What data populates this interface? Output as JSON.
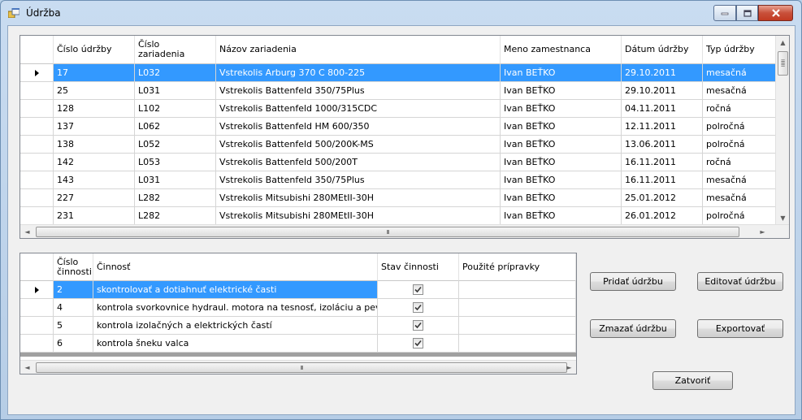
{
  "window": {
    "title": "Údržba",
    "icon": "app-form-icon",
    "buttons": {
      "minimize": "minimize-icon",
      "maximize": "maximize-icon",
      "close": "close-icon"
    }
  },
  "maintenance_grid": {
    "columns": [
      "Číslo údržby",
      "Číslo\nzariadenia",
      "Názov zariadenia",
      "Meno zamestnanca",
      "Dátum údržby",
      "Typ údržby"
    ],
    "rows": [
      [
        "17",
        "L032",
        "Vstrekolis Arburg 370 C 800-225",
        "Ivan BEŤKO",
        "29.10.2011",
        "mesačná"
      ],
      [
        "25",
        "L031",
        "Vstrekolis Battenfeld 350/75Plus",
        "Ivan BEŤKO",
        "29.10.2011",
        "mesačná"
      ],
      [
        "128",
        "L102",
        "Vstrekolis Battenfeld 1000/315CDC",
        "Ivan BEŤKO",
        "04.11.2011",
        "ročná"
      ],
      [
        "137",
        "L062",
        "Vstrekolis Battenfeld HM 600/350",
        "Ivan BEŤKO",
        "12.11.2011",
        "polročná"
      ],
      [
        "138",
        "L052",
        "Vstrekolis Battenfeld 500/200K-MS",
        "Ivan BEŤKO",
        "13.06.2011",
        "polročná"
      ],
      [
        "142",
        "L053",
        "Vstrekolis Battenfeld 500/200T",
        "Ivan BEŤKO",
        "16.11.2011",
        "ročná"
      ],
      [
        "143",
        "L031",
        "Vstrekolis Battenfeld 350/75Plus",
        "Ivan BEŤKO",
        "16.11.2011",
        "mesačná"
      ],
      [
        "227",
        "L282",
        "Vstrekolis Mitsubishi 280MEtII-30H",
        "Ivan BEŤKO",
        "25.01.2012",
        "mesačná"
      ],
      [
        "231",
        "L282",
        "Vstrekolis Mitsubishi 280MEtII-30H",
        "Ivan BEŤKO",
        "26.01.2012",
        "polročná"
      ]
    ],
    "selected_row": 0,
    "scroll_label": "III"
  },
  "activity_grid": {
    "columns": [
      "Číslo\nčinnosti",
      "Činnosť",
      "Stav činnosti",
      "Použité prípravky"
    ],
    "rows": [
      [
        "2",
        "skontrolovať a dotiahnuť elektrické časti",
        "",
        ""
      ],
      [
        "4",
        "kontrola svorkovnice hydraul. motora na tesnosť, izoláciu a pevnosť sp...",
        "",
        ""
      ],
      [
        "5",
        "kontrola izolačných a elektrických častí",
        "",
        ""
      ],
      [
        "6",
        "kontrola šneku valca",
        "",
        ""
      ]
    ],
    "checked": [
      true,
      true,
      true,
      true
    ],
    "selected_row": 0,
    "scroll_label": "III"
  },
  "buttons": {
    "add": "Pridať údržbu",
    "edit": "Editovať údržbu",
    "delete": "Zmazať údržbu",
    "export": "Exportovať",
    "close": "Zatvoriť"
  }
}
